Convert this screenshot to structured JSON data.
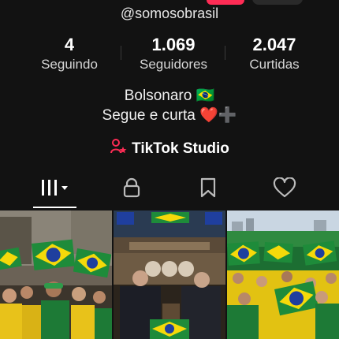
{
  "profile": {
    "username": "@somosobrasil",
    "stats": [
      {
        "value": "4",
        "label": "Seguindo"
      },
      {
        "value": "1.069",
        "label": "Seguidores"
      },
      {
        "value": "2.047",
        "label": "Curtidas"
      }
    ],
    "bio_line1": "Bolsonaro 🇧🇷",
    "bio_line2": "Segue e curta ❤️➕",
    "studio_label": "TikTok Studio"
  },
  "tabs": [
    {
      "icon": "grid-icon",
      "selected": true
    },
    {
      "icon": "lock-icon",
      "selected": false
    },
    {
      "icon": "bookmark-icon",
      "selected": false
    },
    {
      "icon": "heart-icon",
      "selected": false
    }
  ],
  "colors": {
    "background": "#121212",
    "accent": "#fe2c55",
    "brazil_green": "#1e8b3a",
    "brazil_yellow": "#f5d90a",
    "brazil_blue": "#1f3f9e"
  },
  "videos": [
    {
      "icon": "video-thumbnail"
    },
    {
      "icon": "video-thumbnail"
    },
    {
      "icon": "video-thumbnail"
    }
  ]
}
